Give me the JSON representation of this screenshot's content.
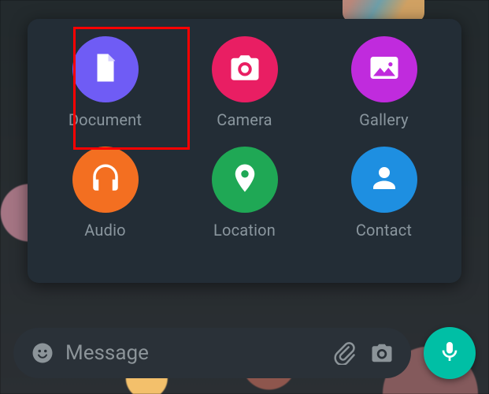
{
  "attach_panel": {
    "items": [
      {
        "label": "Document",
        "color": "#6f5cf5"
      },
      {
        "label": "Camera",
        "color": "#e91e63"
      },
      {
        "label": "Gallery",
        "color": "#c02bdd"
      },
      {
        "label": "Audio",
        "color": "#f36f21"
      },
      {
        "label": "Location",
        "color": "#1fa855"
      },
      {
        "label": "Contact",
        "color": "#1e8fe1"
      }
    ],
    "highlight_index": 0
  },
  "message_bar": {
    "placeholder": "Message"
  }
}
